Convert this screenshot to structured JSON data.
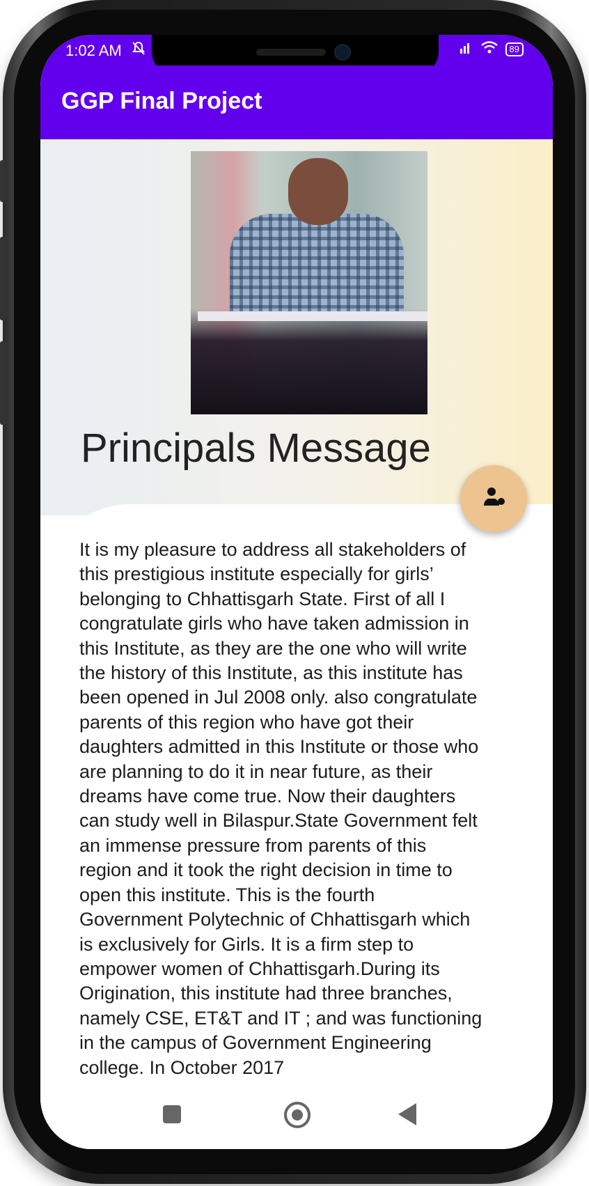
{
  "status_bar": {
    "time": "1:02 AM",
    "battery": "89"
  },
  "app_bar": {
    "title": "GGP Final Project"
  },
  "page": {
    "heading": "Principals Message",
    "message": "It is my pleasure to address all stakeholders of this prestigious institute especially for girls’ belonging to Chhattisgarh State. First of all I congratulate girls who have taken admission in this Institute, as they are the one who will write the history of this Institute, as this institute has been opened in Jul 2008 only. also congratulate parents of this region who have got their daughters admitted in this Institute or those who are planning to do it in near future, as their dreams have come true. Now their daughters can study well in Bilaspur.State Government felt an immense pressure from parents of this region and it took the right decision in time to open this institute. This is the fourth Government Polytechnic of Chhattisgarh which is exclusively for Girls. It is a firm step to empower women of Chhattisgarh.During its Origination, this institute had three branches, namely CSE, ET&T and IT ; and was functioning in the campus of Government Engineering college. In October 2017"
  },
  "colors": {
    "app_bar": "#6200ee",
    "fab": "#edc38f",
    "header_gradient_left": "#e9eef3",
    "header_gradient_right": "#fbefc8"
  },
  "icons": {
    "fab": "person-add-icon",
    "status_mute": "notification-muted-icon",
    "status_signal": "signal-icon",
    "status_wifi": "wifi-icon",
    "status_battery": "battery-icon"
  }
}
